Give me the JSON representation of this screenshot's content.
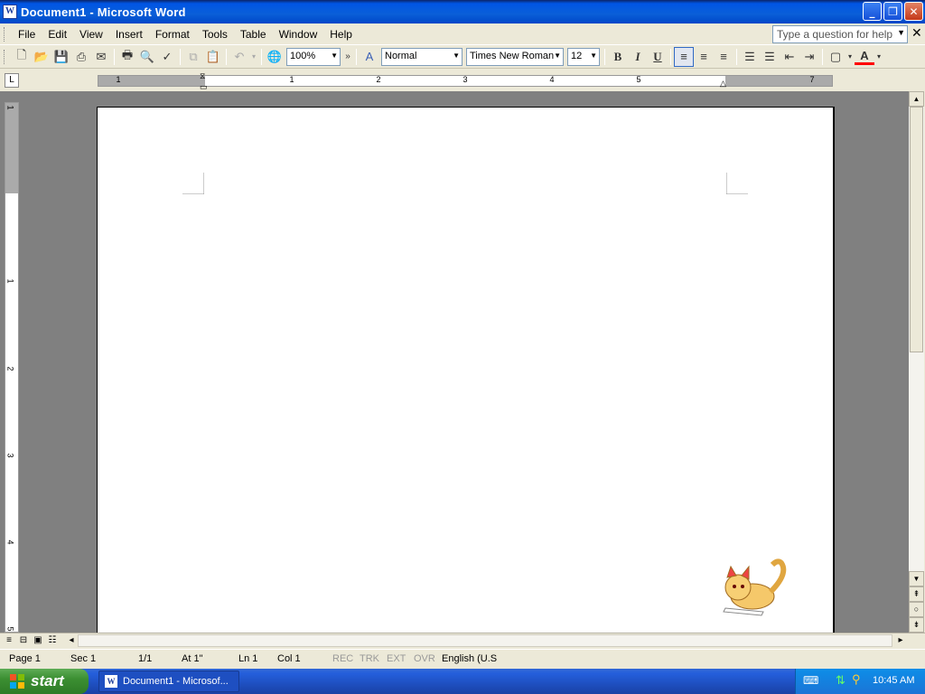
{
  "window": {
    "title": "Document1 - Microsoft Word",
    "app_icon": "word-icon"
  },
  "menu": {
    "items": [
      {
        "label": "File"
      },
      {
        "label": "Edit"
      },
      {
        "label": "View"
      },
      {
        "label": "Insert"
      },
      {
        "label": "Format"
      },
      {
        "label": "Tools"
      },
      {
        "label": "Table"
      },
      {
        "label": "Window"
      },
      {
        "label": "Help"
      }
    ],
    "help_placeholder": "Type a question for help"
  },
  "toolbar": {
    "zoom": "100%",
    "style": "Normal",
    "font": "Times New Roman",
    "size": "12",
    "bold": "B",
    "italic": "I",
    "underline": "U"
  },
  "ruler": {
    "numbers": [
      "1",
      "1",
      "2",
      "3",
      "4",
      "5",
      "7"
    ],
    "vertical_numbers": [
      "1",
      "1",
      "2",
      "3",
      "4",
      "5"
    ],
    "tab_selector": "L"
  },
  "status": {
    "page": "Page 1",
    "sec": "Sec 1",
    "pages": "1/1",
    "at": "At 1\"",
    "ln": "Ln 1",
    "col": "Col 1",
    "rec": "REC",
    "trk": "TRK",
    "ext": "EXT",
    "ovr": "OVR",
    "language": "English (U.S"
  },
  "taskbar": {
    "start": "start",
    "item": "Document1 - Microsof...",
    "clock": "10:45 AM"
  },
  "colors": {
    "titlebar": "#0a5fd8",
    "taskbar": "#245edb",
    "start": "#3c8f32",
    "font_color_bar": "#ff0000"
  }
}
